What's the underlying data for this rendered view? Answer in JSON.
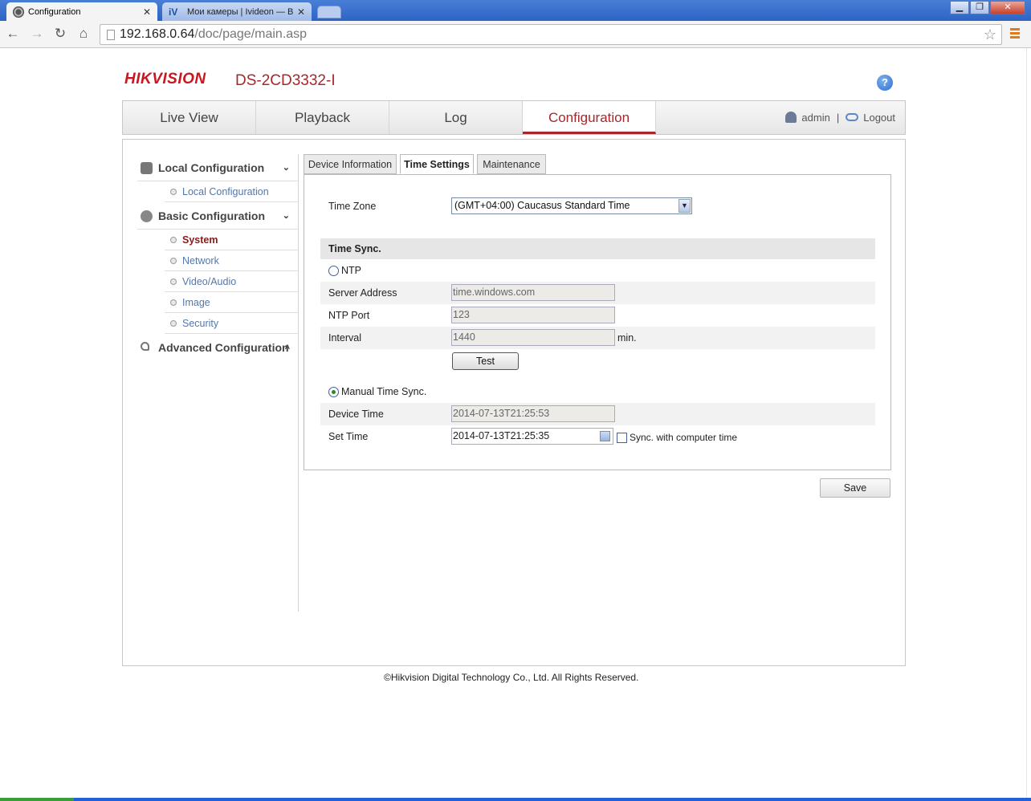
{
  "browser": {
    "tabs": [
      {
        "title": "Configuration",
        "active": true
      },
      {
        "title": "Мои камеры | Ivideon — Ви",
        "active": false,
        "favicon_text": "iV"
      }
    ],
    "url_host": "192.168.0.64",
    "url_path": "/doc/page/main.asp",
    "window_buttons": {
      "minimize": "▁",
      "restore": "❐",
      "close": "✕"
    }
  },
  "header": {
    "brand": "HIKVISION",
    "model": "DS-2CD3332-I",
    "help_glyph": "?"
  },
  "main_nav": {
    "items": [
      {
        "label": "Live View"
      },
      {
        "label": "Playback"
      },
      {
        "label": "Log"
      },
      {
        "label": "Configuration",
        "active": true
      }
    ],
    "user": "admin",
    "separator": "|",
    "logout": "Logout"
  },
  "sidebar": {
    "groups": [
      {
        "label": "Local Configuration",
        "icon": "monitor-icon",
        "caret": "⌄",
        "items": [
          {
            "label": "Local Configuration"
          }
        ]
      },
      {
        "label": "Basic Configuration",
        "icon": "gear-icon",
        "caret": "⌄",
        "items": [
          {
            "label": "System",
            "active": true
          },
          {
            "label": "Network"
          },
          {
            "label": "Video/Audio"
          },
          {
            "label": "Image"
          },
          {
            "label": "Security"
          }
        ]
      },
      {
        "label": "Advanced Configuration",
        "icon": "wrench-icon",
        "caret": "˄",
        "items": []
      }
    ]
  },
  "content_tabs": [
    {
      "label": "Device Information"
    },
    {
      "label": "Time Settings",
      "active": true
    },
    {
      "label": "Maintenance"
    }
  ],
  "time_settings": {
    "time_zone_label": "Time Zone",
    "time_zone_value": "(GMT+04:00) Caucasus Standard Time",
    "time_sync_heading": "Time Sync.",
    "ntp_label": "NTP",
    "ntp_selected": false,
    "server_address_label": "Server Address",
    "server_address_value": "time.windows.com",
    "ntp_port_label": "NTP Port",
    "ntp_port_value": "123",
    "interval_label": "Interval",
    "interval_value": "1440",
    "interval_unit": "min.",
    "test_button": "Test",
    "manual_label": "Manual Time Sync.",
    "manual_selected": true,
    "device_time_label": "Device Time",
    "device_time_value": "2014-07-13T21:25:53",
    "set_time_label": "Set Time",
    "set_time_value": "2014-07-13T21:25:35",
    "sync_computer_label": "Sync. with computer time",
    "sync_computer_checked": false
  },
  "save_button": "Save",
  "footer": "©Hikvision Digital Technology Co., Ltd. All Rights Reserved.",
  "colors": {
    "accent": "#a5282c",
    "brand": "#c8171e",
    "link": "#5577a8"
  }
}
